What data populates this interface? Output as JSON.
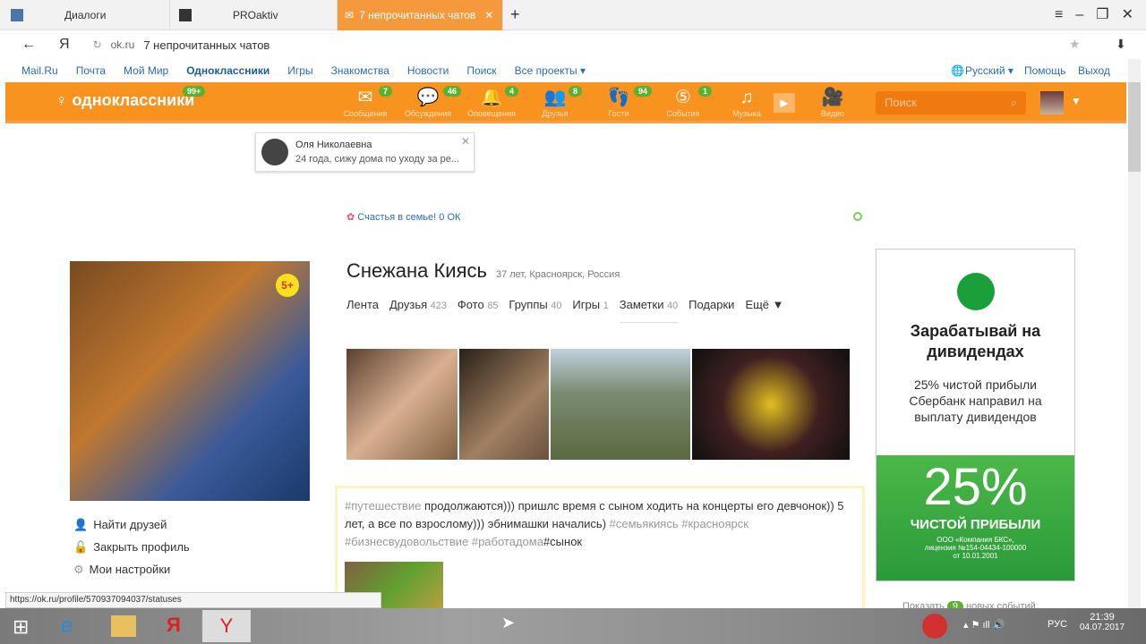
{
  "tabs": [
    {
      "label": "Диалоги"
    },
    {
      "label": "PROaktiv"
    },
    {
      "label": "7 непрочитанных чатов"
    }
  ],
  "address": {
    "domain": "ok.ru",
    "title": "7 непрочитанных чатов"
  },
  "portal": {
    "links": [
      "Mail.Ru",
      "Почта",
      "Мой Мир",
      "Одноклассники",
      "Игры",
      "Знакомства",
      "Новости",
      "Поиск",
      "Все проекты ▾"
    ],
    "lang": "Русский ▾",
    "help": "Помощь",
    "exit": "Выход"
  },
  "ok": {
    "logo": "одноклассники",
    "logo_badge": "99+",
    "search_placeholder": "Поиск",
    "nav": [
      {
        "label": "Сообщения",
        "icon": "envelope-icon",
        "badge": "7"
      },
      {
        "label": "Обсуждения",
        "icon": "chat-icon",
        "badge": "46"
      },
      {
        "label": "Оповещения",
        "icon": "bell-icon",
        "badge": "4"
      },
      {
        "label": "Друзья",
        "icon": "friends-icon",
        "badge": "8"
      },
      {
        "label": "Гости",
        "icon": "footprints-icon",
        "badge": "94"
      },
      {
        "label": "События",
        "icon": "events-icon",
        "badge": "1"
      },
      {
        "label": "Музыка",
        "icon": "music-icon",
        "badge": ""
      },
      {
        "label": "Видео",
        "icon": "video-icon",
        "badge": ""
      }
    ]
  },
  "notification": {
    "name": "Оля Николаевна",
    "text": "24 года, сижу дома по уходу за ре..."
  },
  "promo": "Счастья в семье! 0 ОК",
  "profile": {
    "name": "Снежана Киясь",
    "info": "37 лет, Красноярск, Россия",
    "photo_badge": "5+",
    "tabs": [
      {
        "label": "Лента",
        "count": ""
      },
      {
        "label": "Друзья",
        "count": "423"
      },
      {
        "label": "Фото",
        "count": "85"
      },
      {
        "label": "Группы",
        "count": "40"
      },
      {
        "label": "Игры",
        "count": "1"
      },
      {
        "label": "Заметки",
        "count": "40"
      },
      {
        "label": "Подарки",
        "count": ""
      },
      {
        "label": "Ещё ▼",
        "count": ""
      }
    ]
  },
  "left_menu": [
    "Найти друзей",
    "Закрыть профиль",
    "Мои настройки"
  ],
  "post": {
    "h1": "#путешествие",
    "t1": " продолжаются))) пришлс время с сыном ходить на концерты его девчонок)) 5 лет, а все по взрослому))) эбнимашки начались) ",
    "h2": "#семьякиясь #красноярск #бизнесвудовольствие #работадома",
    "t2": "#сынок"
  },
  "ad": {
    "title": "Зарабатывай на дивидендах",
    "text": "25% чистой прибыли Сбербанк направил на выплату дивидендов",
    "big": "25%",
    "sub": "ЧИСТОЙ ПРИБЫЛИ",
    "legal": "ООО «Компания БКС», лицензия №154-04434-100000 от 10.01.2001"
  },
  "events": {
    "pre": "Показать",
    "count": "9",
    "post": "новых событий"
  },
  "status_url": "https://ok.ru/profile/570937094037/statuses",
  "tray": {
    "lang": "РУС",
    "time": "21:39",
    "date": "04.07.2017"
  }
}
